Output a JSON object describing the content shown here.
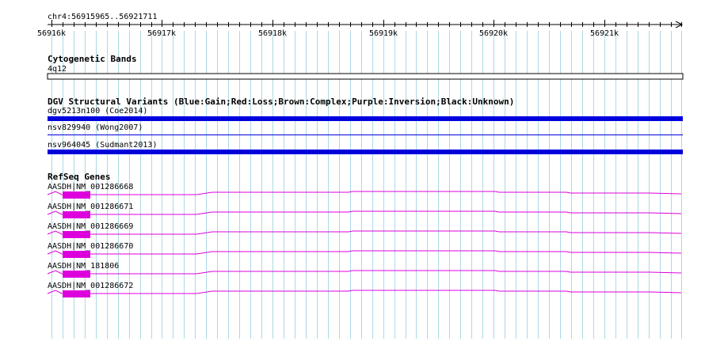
{
  "location": "chr4:56915965..56921711",
  "ruler": {
    "ticks": [
      {
        "label": "56916k",
        "pos": 56916000
      },
      {
        "label": "56917k",
        "pos": 56917000
      },
      {
        "label": "56918k",
        "pos": 56918000
      },
      {
        "label": "56919k",
        "pos": 56919000
      },
      {
        "label": "56920k",
        "pos": 56920000
      },
      {
        "label": "56921k",
        "pos": 56921000
      }
    ],
    "start": 56915965,
    "end": 56921711
  },
  "tracks": {
    "cytobands": {
      "title": "Cytogenetic Bands",
      "band_label": "4q12"
    },
    "dgv": {
      "title": "DGV Structural Variants (Blue:Gain;Red:Loss;Brown:Complex;Purple:Inversion;Black:Unknown)",
      "features": [
        {
          "label": "dgv5213n100 (Coe2014)",
          "type": "gain",
          "thick": true
        },
        {
          "label": "nsv829940 (Wong2007)",
          "type": "gain",
          "thick": false
        },
        {
          "label": "nsv964045 (Sudmant2013)",
          "type": "gain",
          "thick": true
        }
      ]
    },
    "refseq": {
      "title": "RefSeq Genes",
      "genes": [
        {
          "label": "AASDH|NM_001286668"
        },
        {
          "label": "AASDH|NM_001286671"
        },
        {
          "label": "AASDH|NM_001286669"
        },
        {
          "label": "AASDH|NM_001286670"
        },
        {
          "label": "AASDH|NM_181806"
        },
        {
          "label": "AASDH|NM_001286672"
        }
      ]
    }
  },
  "colors": {
    "gridline": "#add8e6",
    "gain": "#0000dd",
    "gene": "#dd00dd",
    "ruler": "#000000"
  }
}
